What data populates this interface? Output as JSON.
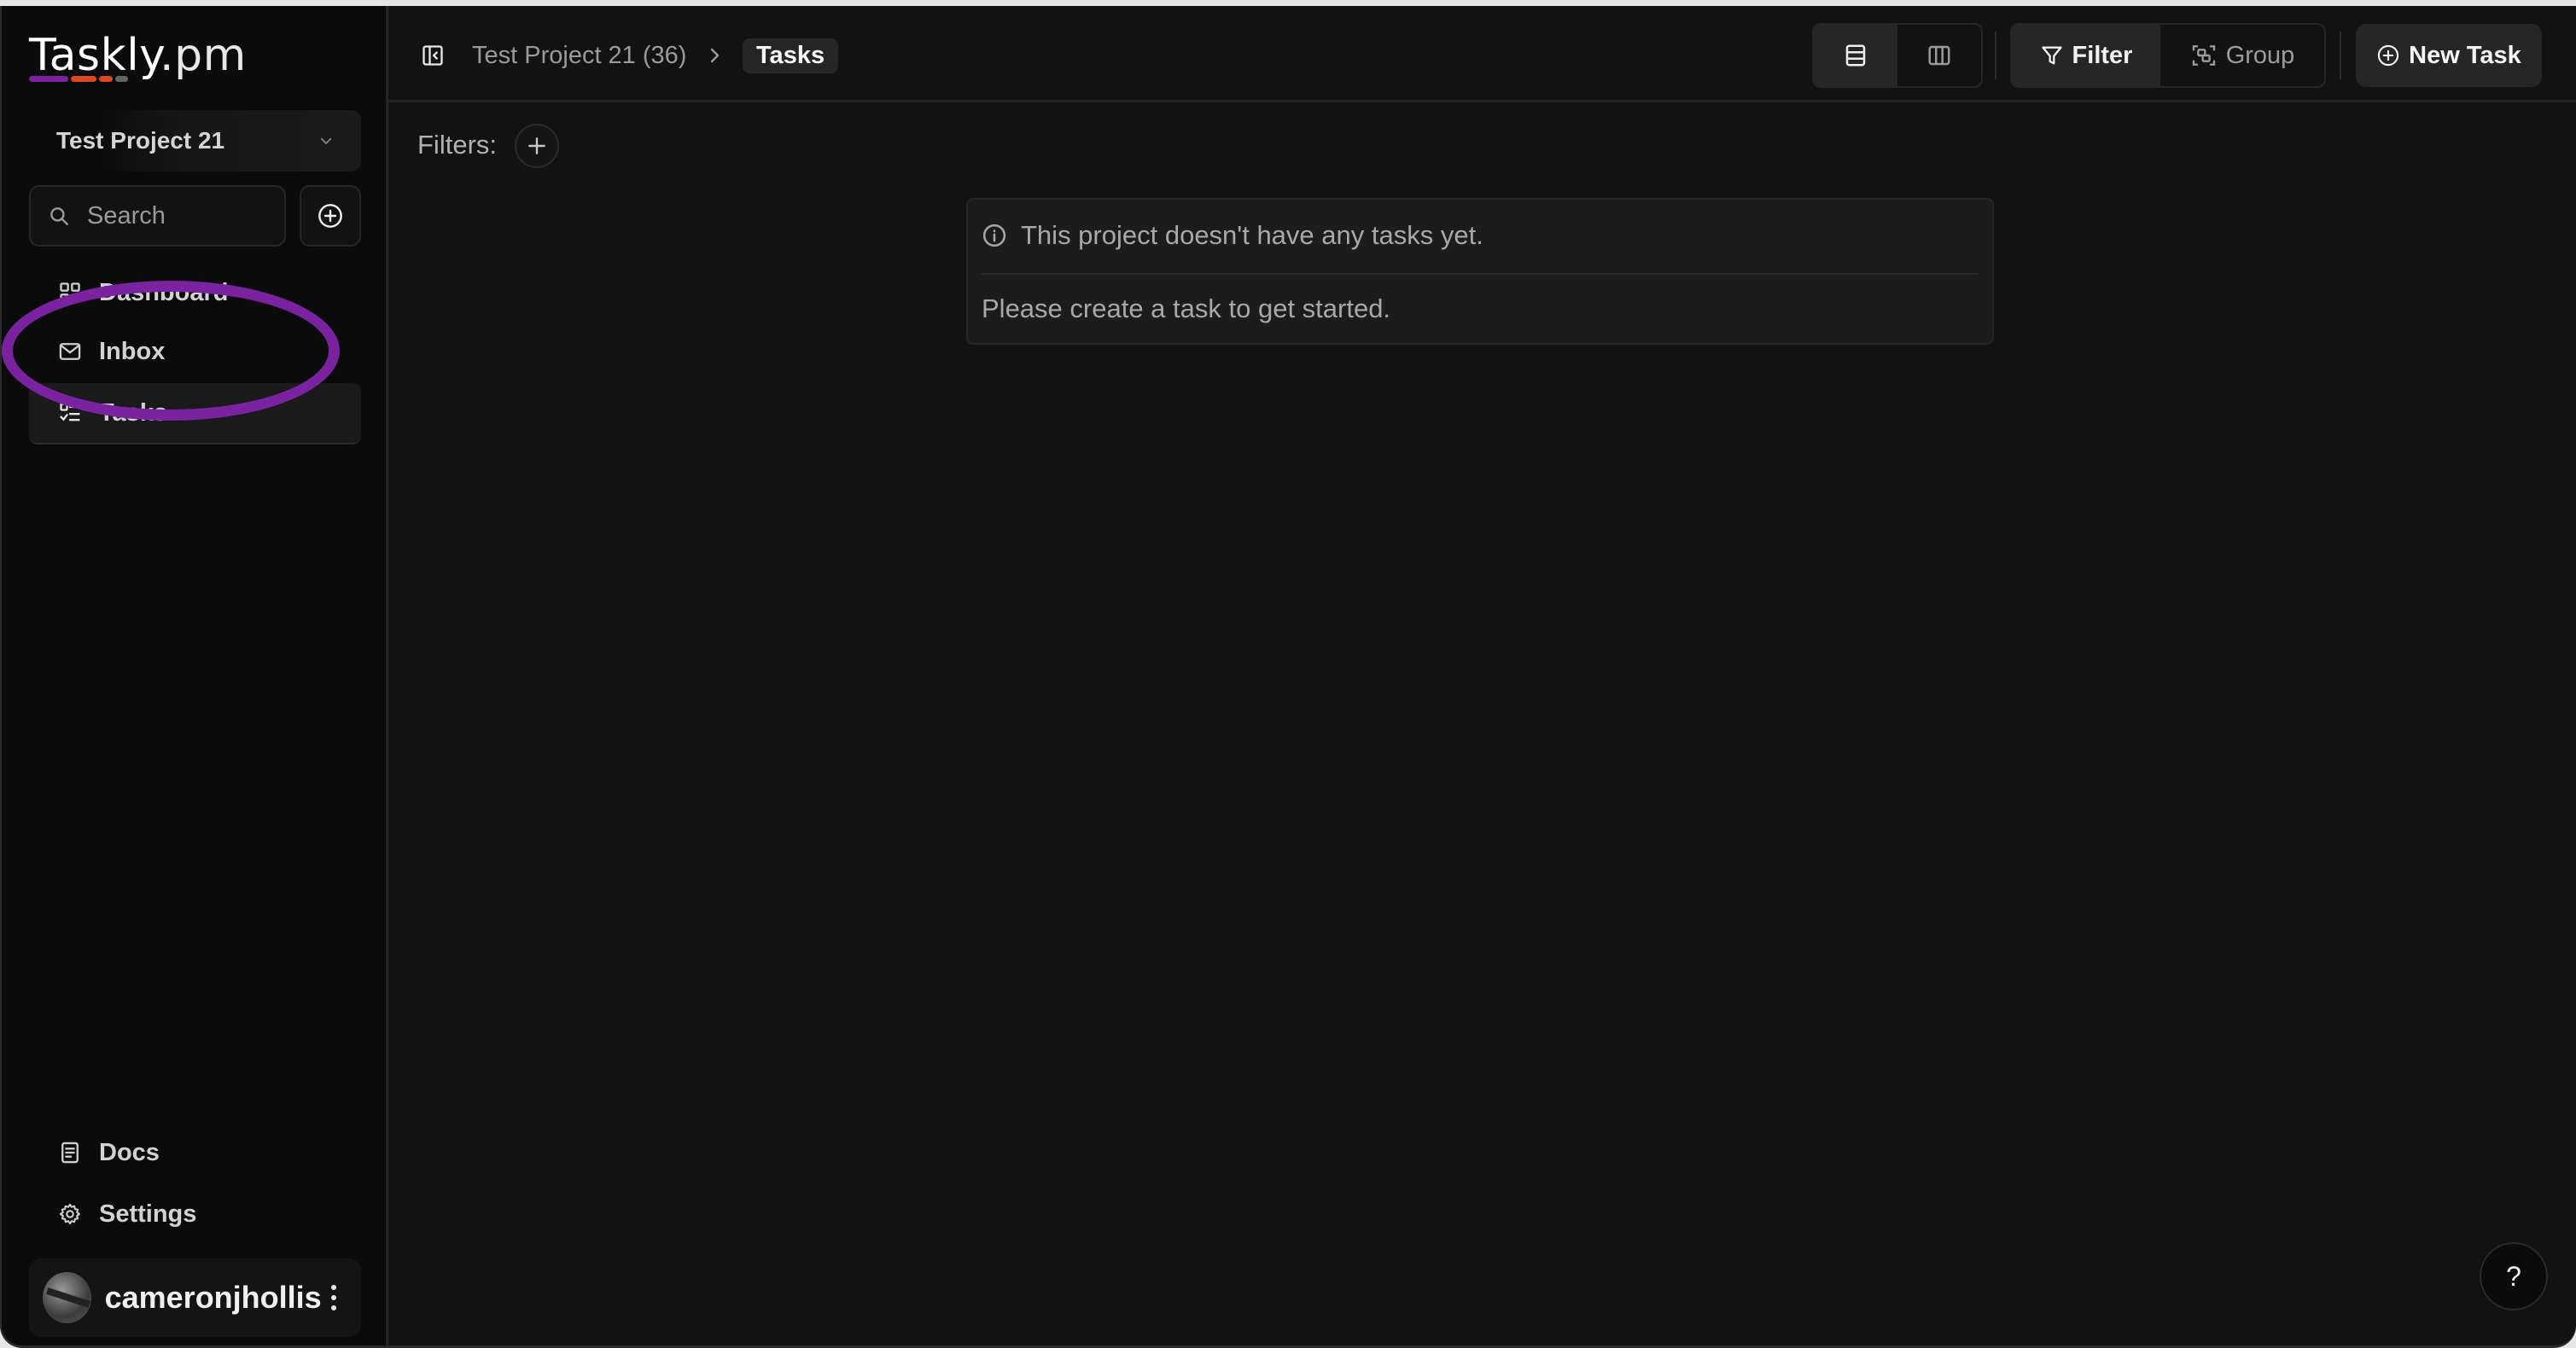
{
  "app": {
    "logo_main": "Taskly",
    "logo_suffix": ".pm",
    "logo_bar_colors": [
      "#7a22a0",
      "#d9481f",
      "#d9481f",
      "#5f6660"
    ]
  },
  "sidebar": {
    "project_selector": {
      "label": "Test Project 21"
    },
    "search": {
      "placeholder": "Search",
      "value": ""
    },
    "nav_items": [
      {
        "label": "Dashboard",
        "icon": "dashboard-grid-icon",
        "active": false
      },
      {
        "label": "Inbox",
        "icon": "mail-icon",
        "active": false
      },
      {
        "label": "Tasks",
        "icon": "checklist-icon",
        "active": true
      }
    ],
    "bottom_items": [
      {
        "label": "Docs",
        "icon": "document-icon"
      },
      {
        "label": "Settings",
        "icon": "gear-icon"
      }
    ],
    "user": {
      "name": "cameronjhollis"
    }
  },
  "annotation": {
    "color": "#7a22a0",
    "target": "Inbox"
  },
  "header": {
    "breadcrumb": [
      {
        "label": "Test Project 21 (36)"
      },
      {
        "label": "Tasks",
        "current": true
      }
    ],
    "view_modes": [
      {
        "name": "list-view",
        "active": true
      },
      {
        "name": "board-view",
        "active": false
      }
    ],
    "filter_label": "Filter",
    "group_label": "Group",
    "new_task_label": "New Task"
  },
  "filters": {
    "label": "Filters:"
  },
  "empty_state": {
    "title": "This project doesn't have any tasks yet.",
    "message": "Please create a task to get started."
  },
  "help": {
    "label": "?"
  }
}
